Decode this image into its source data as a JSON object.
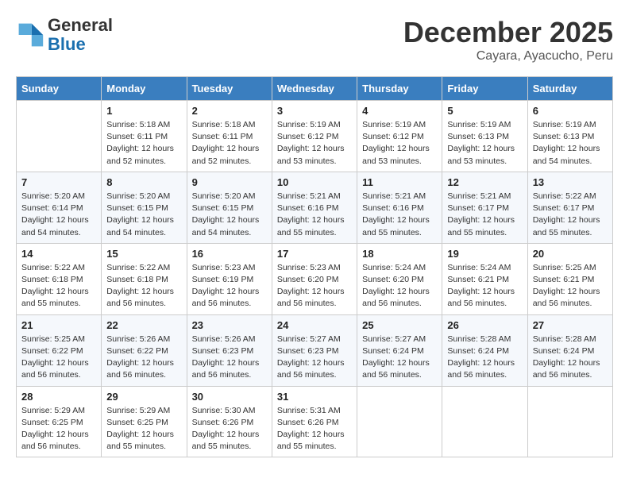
{
  "header": {
    "logo_line1": "General",
    "logo_line2": "Blue",
    "month": "December 2025",
    "location": "Cayara, Ayacucho, Peru"
  },
  "days_of_week": [
    "Sunday",
    "Monday",
    "Tuesday",
    "Wednesday",
    "Thursday",
    "Friday",
    "Saturday"
  ],
  "weeks": [
    [
      {
        "num": "",
        "info": ""
      },
      {
        "num": "1",
        "info": "Sunrise: 5:18 AM\nSunset: 6:11 PM\nDaylight: 12 hours\nand 52 minutes."
      },
      {
        "num": "2",
        "info": "Sunrise: 5:18 AM\nSunset: 6:11 PM\nDaylight: 12 hours\nand 52 minutes."
      },
      {
        "num": "3",
        "info": "Sunrise: 5:19 AM\nSunset: 6:12 PM\nDaylight: 12 hours\nand 53 minutes."
      },
      {
        "num": "4",
        "info": "Sunrise: 5:19 AM\nSunset: 6:12 PM\nDaylight: 12 hours\nand 53 minutes."
      },
      {
        "num": "5",
        "info": "Sunrise: 5:19 AM\nSunset: 6:13 PM\nDaylight: 12 hours\nand 53 minutes."
      },
      {
        "num": "6",
        "info": "Sunrise: 5:19 AM\nSunset: 6:13 PM\nDaylight: 12 hours\nand 54 minutes."
      }
    ],
    [
      {
        "num": "7",
        "info": "Sunrise: 5:20 AM\nSunset: 6:14 PM\nDaylight: 12 hours\nand 54 minutes."
      },
      {
        "num": "8",
        "info": "Sunrise: 5:20 AM\nSunset: 6:15 PM\nDaylight: 12 hours\nand 54 minutes."
      },
      {
        "num": "9",
        "info": "Sunrise: 5:20 AM\nSunset: 6:15 PM\nDaylight: 12 hours\nand 54 minutes."
      },
      {
        "num": "10",
        "info": "Sunrise: 5:21 AM\nSunset: 6:16 PM\nDaylight: 12 hours\nand 55 minutes."
      },
      {
        "num": "11",
        "info": "Sunrise: 5:21 AM\nSunset: 6:16 PM\nDaylight: 12 hours\nand 55 minutes."
      },
      {
        "num": "12",
        "info": "Sunrise: 5:21 AM\nSunset: 6:17 PM\nDaylight: 12 hours\nand 55 minutes."
      },
      {
        "num": "13",
        "info": "Sunrise: 5:22 AM\nSunset: 6:17 PM\nDaylight: 12 hours\nand 55 minutes."
      }
    ],
    [
      {
        "num": "14",
        "info": "Sunrise: 5:22 AM\nSunset: 6:18 PM\nDaylight: 12 hours\nand 55 minutes."
      },
      {
        "num": "15",
        "info": "Sunrise: 5:22 AM\nSunset: 6:18 PM\nDaylight: 12 hours\nand 56 minutes."
      },
      {
        "num": "16",
        "info": "Sunrise: 5:23 AM\nSunset: 6:19 PM\nDaylight: 12 hours\nand 56 minutes."
      },
      {
        "num": "17",
        "info": "Sunrise: 5:23 AM\nSunset: 6:20 PM\nDaylight: 12 hours\nand 56 minutes."
      },
      {
        "num": "18",
        "info": "Sunrise: 5:24 AM\nSunset: 6:20 PM\nDaylight: 12 hours\nand 56 minutes."
      },
      {
        "num": "19",
        "info": "Sunrise: 5:24 AM\nSunset: 6:21 PM\nDaylight: 12 hours\nand 56 minutes."
      },
      {
        "num": "20",
        "info": "Sunrise: 5:25 AM\nSunset: 6:21 PM\nDaylight: 12 hours\nand 56 minutes."
      }
    ],
    [
      {
        "num": "21",
        "info": "Sunrise: 5:25 AM\nSunset: 6:22 PM\nDaylight: 12 hours\nand 56 minutes."
      },
      {
        "num": "22",
        "info": "Sunrise: 5:26 AM\nSunset: 6:22 PM\nDaylight: 12 hours\nand 56 minutes."
      },
      {
        "num": "23",
        "info": "Sunrise: 5:26 AM\nSunset: 6:23 PM\nDaylight: 12 hours\nand 56 minutes."
      },
      {
        "num": "24",
        "info": "Sunrise: 5:27 AM\nSunset: 6:23 PM\nDaylight: 12 hours\nand 56 minutes."
      },
      {
        "num": "25",
        "info": "Sunrise: 5:27 AM\nSunset: 6:24 PM\nDaylight: 12 hours\nand 56 minutes."
      },
      {
        "num": "26",
        "info": "Sunrise: 5:28 AM\nSunset: 6:24 PM\nDaylight: 12 hours\nand 56 minutes."
      },
      {
        "num": "27",
        "info": "Sunrise: 5:28 AM\nSunset: 6:24 PM\nDaylight: 12 hours\nand 56 minutes."
      }
    ],
    [
      {
        "num": "28",
        "info": "Sunrise: 5:29 AM\nSunset: 6:25 PM\nDaylight: 12 hours\nand 56 minutes."
      },
      {
        "num": "29",
        "info": "Sunrise: 5:29 AM\nSunset: 6:25 PM\nDaylight: 12 hours\nand 55 minutes."
      },
      {
        "num": "30",
        "info": "Sunrise: 5:30 AM\nSunset: 6:26 PM\nDaylight: 12 hours\nand 55 minutes."
      },
      {
        "num": "31",
        "info": "Sunrise: 5:31 AM\nSunset: 6:26 PM\nDaylight: 12 hours\nand 55 minutes."
      },
      {
        "num": "",
        "info": ""
      },
      {
        "num": "",
        "info": ""
      },
      {
        "num": "",
        "info": ""
      }
    ]
  ]
}
